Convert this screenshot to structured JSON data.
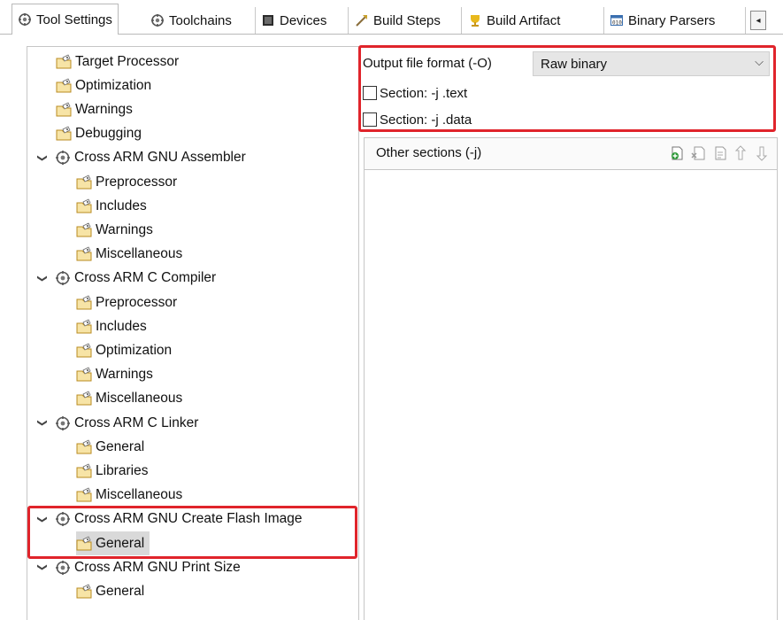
{
  "tabs": [
    {
      "label": "Tool Settings",
      "icon": "tool-settings-icon",
      "active": true
    },
    {
      "label": "Toolchains",
      "icon": "toolchains-icon"
    },
    {
      "label": "Devices",
      "icon": "devices-icon"
    },
    {
      "label": "Build Steps",
      "icon": "build-steps-icon"
    },
    {
      "label": "Build Artifact",
      "icon": "build-artifact-icon"
    },
    {
      "label": "Binary Parsers",
      "icon": "binary-parsers-icon"
    }
  ],
  "tab_scroll_icon": "scroll-left-icon",
  "tree": {
    "items": [
      {
        "label": "Target Processor",
        "level": 1
      },
      {
        "label": "Optimization",
        "level": 1
      },
      {
        "label": "Warnings",
        "level": 1
      },
      {
        "label": "Debugging",
        "level": 1
      },
      {
        "label": "Cross ARM GNU Assembler",
        "level": 0,
        "expanded": true
      },
      {
        "label": "Preprocessor",
        "level": 2
      },
      {
        "label": "Includes",
        "level": 2
      },
      {
        "label": "Warnings",
        "level": 2
      },
      {
        "label": "Miscellaneous",
        "level": 2
      },
      {
        "label": "Cross ARM C Compiler",
        "level": 0,
        "expanded": true
      },
      {
        "label": "Preprocessor",
        "level": 2
      },
      {
        "label": "Includes",
        "level": 2
      },
      {
        "label": "Optimization",
        "level": 2
      },
      {
        "label": "Warnings",
        "level": 2
      },
      {
        "label": "Miscellaneous",
        "level": 2
      },
      {
        "label": "Cross ARM C Linker",
        "level": 0,
        "expanded": true
      },
      {
        "label": "General",
        "level": 2
      },
      {
        "label": "Libraries",
        "level": 2
      },
      {
        "label": "Miscellaneous",
        "level": 2
      },
      {
        "label": "Cross ARM GNU Create Flash Image",
        "level": 0,
        "expanded": true
      },
      {
        "label": "General",
        "level": 2,
        "selected": true
      },
      {
        "label": "Cross ARM GNU Print Size",
        "level": 0,
        "expanded": true
      },
      {
        "label": "General",
        "level": 2
      }
    ]
  },
  "output_format": {
    "label": "Output file format (-O)",
    "value": "Raw binary"
  },
  "sections": [
    {
      "label": "Section: -j .text",
      "checked": false
    },
    {
      "label": "Section: -j .data",
      "checked": false
    }
  ],
  "other_sections": {
    "title": "Other sections (-j)",
    "tools": [
      "add-icon",
      "delete-icon",
      "edit-icon",
      "move-up-icon",
      "move-down-icon"
    ]
  },
  "highlight_color": "#e0242b"
}
